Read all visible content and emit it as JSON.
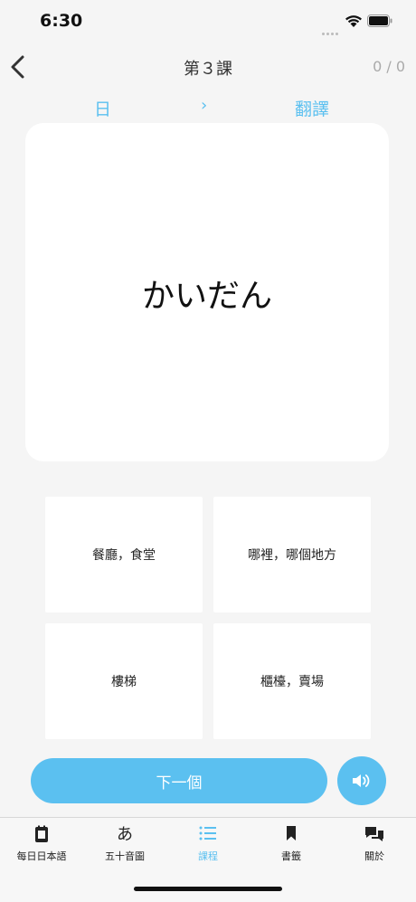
{
  "status": {
    "time": "6:30"
  },
  "nav": {
    "title": "第３課",
    "counter": "0 / 0"
  },
  "mode": {
    "from": "日",
    "arrow": "›",
    "to": "翻譯"
  },
  "card": {
    "word": "かいだん"
  },
  "options": [
    "餐廳，食堂",
    "哪裡，哪個地方",
    "樓梯",
    "櫃檯，賣場"
  ],
  "actions": {
    "next_label": "下一個",
    "sound_icon": "speaker-icon"
  },
  "tabs": [
    {
      "label": "每日日本語",
      "icon": "notebook-icon"
    },
    {
      "label": "五十音圖",
      "icon": "hiragana-a-icon",
      "glyph": "あ"
    },
    {
      "label": "課程",
      "icon": "list-icon",
      "active": true
    },
    {
      "label": "書籤",
      "icon": "bookmark-icon"
    },
    {
      "label": "關於",
      "icon": "chat-icon"
    }
  ],
  "colors": {
    "accent": "#5bc0f0",
    "background": "#f5f5f5"
  }
}
